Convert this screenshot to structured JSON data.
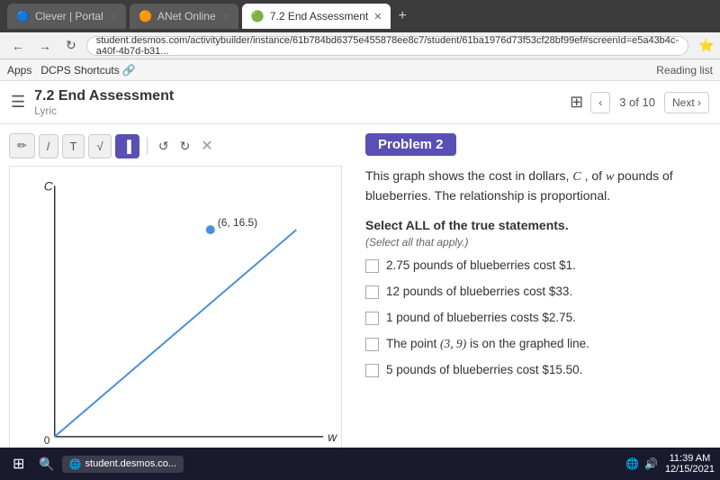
{
  "browser": {
    "tabs": [
      {
        "id": "clever",
        "label": "Clever | Portal",
        "favicon": "🔵",
        "active": false
      },
      {
        "id": "anet",
        "label": "ANet Online",
        "favicon": "🟠",
        "active": false
      },
      {
        "id": "assessment",
        "label": "7.2 End Assessment",
        "favicon": "🟢",
        "active": true
      }
    ],
    "address": "student.desmos.com/activitybuilder/instance/61b784bd6375e455878ee8c7/student/61ba1976d73f53cf28bf99ef#screenId=e5a43b4c-a40f-4b7d-b31...",
    "bookmarks": [
      "Apps",
      "DCPS Shortcuts"
    ]
  },
  "header": {
    "title": "7.2 End Assessment",
    "subtitle": "Lyric",
    "grid_icon": "⊞",
    "page_indicator": "3 of 10",
    "next_label": "Next",
    "prev_icon": "‹",
    "next_icon": "›"
  },
  "toolbar": {
    "pencil_icon": "✏",
    "line_icon": "/",
    "text_icon": "T",
    "sqrt_icon": "√",
    "highlight_icon": "▐",
    "undo_icon": "↺",
    "redo_icon": "↻",
    "close_icon": "✕"
  },
  "graph": {
    "point_label": "(6, 16.5)",
    "x_axis_label": "w",
    "y_axis_label": "C",
    "origin_label": "0"
  },
  "problem": {
    "title": "Problem 2",
    "description_1": "This graph shows the cost in dollars,",
    "cost_var": "C",
    "description_2": ", of",
    "weight_var": "w",
    "description_3": "pounds of blueberries. The relationship is proportional.",
    "select_label": "Select ALL of the true statements.",
    "select_hint": "(Select all that apply.)",
    "options": [
      {
        "id": 1,
        "text": "2.75 pounds of blueberries cost $1."
      },
      {
        "id": 2,
        "text": "12 pounds of blueberries cost $33."
      },
      {
        "id": 3,
        "text": "1 pound of blueberries costs $2.75."
      },
      {
        "id": 4,
        "text": "The point (3, 9) is on the graphed line."
      },
      {
        "id": 5,
        "text": "5 pounds of blueberries cost $15.50."
      }
    ]
  },
  "taskbar": {
    "time": "11:39 AM",
    "date": "12/15/2021",
    "chrome_label": "student.desmos.co..."
  }
}
